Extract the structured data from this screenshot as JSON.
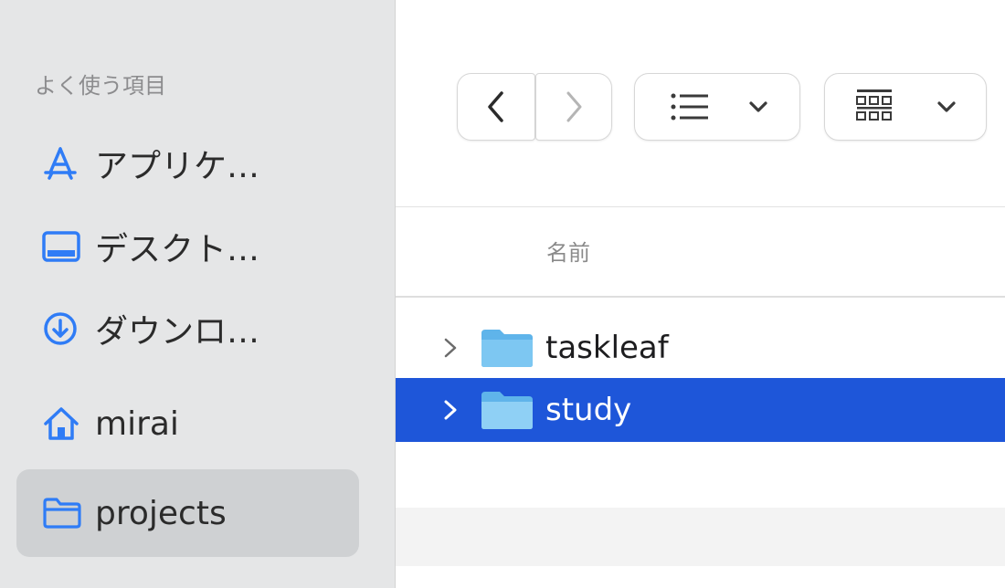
{
  "sidebar": {
    "heading": "よく使う項目",
    "items": [
      {
        "label": "アプリケ…",
        "icon": "applications-icon"
      },
      {
        "label": "デスクト…",
        "icon": "desktop-icon"
      },
      {
        "label": "ダウンロ…",
        "icon": "downloads-icon"
      },
      {
        "label": "mirai",
        "icon": "home-icon"
      },
      {
        "label": "projects",
        "icon": "folder-icon",
        "selected": true
      }
    ]
  },
  "toolbar": {
    "back": "<",
    "forward": ">",
    "list_view": "list-view-icon",
    "group_view": "grid-view-icon"
  },
  "file_list": {
    "column_header": "名前",
    "rows": [
      {
        "name": "taskleaf",
        "selected": false
      },
      {
        "name": "study",
        "selected": true
      }
    ]
  },
  "colors": {
    "accent": "#1e56d9",
    "icon_blue": "#2f7cf6",
    "sidebar_bg": "#e5e6e7"
  }
}
